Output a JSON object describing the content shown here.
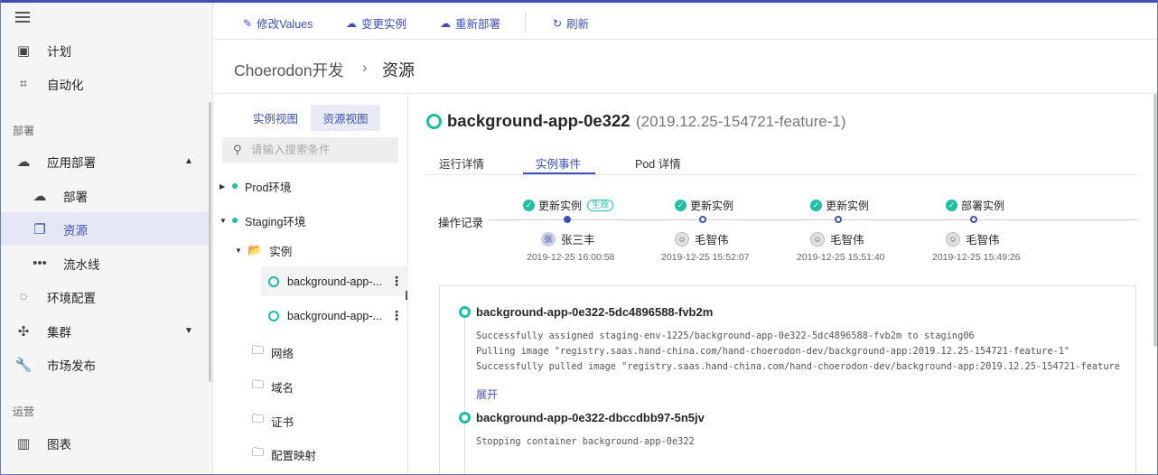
{
  "sidebar": {
    "items": [
      {
        "label": "计划",
        "icon": "calendar-icon"
      },
      {
        "label": "自动化",
        "icon": "automation-icon"
      },
      {
        "label": "应用部署",
        "icon": "cloud-icon"
      },
      {
        "label": "部署",
        "icon": "cloud-upload-icon"
      },
      {
        "label": "资源",
        "icon": "file-copy-icon"
      },
      {
        "label": "流水线",
        "icon": "dots-icon"
      },
      {
        "label": "环境配置",
        "icon": "ring-icon"
      },
      {
        "label": "集群",
        "icon": "cluster-icon"
      },
      {
        "label": "市场发布",
        "icon": "wrench-icon"
      },
      {
        "label": "图表",
        "icon": "chart-icon"
      }
    ],
    "sections": {
      "deploy": "部署",
      "ops": "运营"
    }
  },
  "toolbar": {
    "modify_values": "修改Values",
    "change_instance": "变更实例",
    "redeploy": "重新部署",
    "refresh": "刷新"
  },
  "breadcrumb": {
    "project": "Choerodon开发",
    "separator": "›",
    "current": "资源"
  },
  "tree": {
    "tab_instance": "实例视图",
    "tab_resource": "资源视图",
    "search_placeholder": "请输入搜索条件",
    "env_prod": "Prod环境",
    "env_staging": "Staging环境",
    "folder_instance": "实例",
    "instances": [
      "background-app-...",
      "background-app-..."
    ],
    "folders": [
      "网络",
      "域名",
      "证书",
      "配置映射"
    ]
  },
  "detail": {
    "title": "background-app-0e322",
    "version": "(2019.12.25-154721-feature-1)",
    "tabs": [
      "运行详情",
      "实例事件",
      "Pod 详情"
    ],
    "record_label": "操作记录",
    "records": [
      {
        "action": "更新实例",
        "tag": "生效",
        "user": "张三丰",
        "avatar": "张",
        "time": "2019-12-25 16:00:58"
      },
      {
        "action": "更新实例",
        "tag": "",
        "user": "毛智伟",
        "avatar": "",
        "time": "2019-12-25 15:52:07"
      },
      {
        "action": "更新实例",
        "tag": "",
        "user": "毛智伟",
        "avatar": "",
        "time": "2019-12-25 15:51:40"
      },
      {
        "action": "部署实例",
        "tag": "",
        "user": "毛智伟",
        "avatar": "",
        "time": "2019-12-25 15:49:26"
      }
    ],
    "events": [
      {
        "name": "background-app-0e322-5dc4896588-fvb2m",
        "logs": [
          "Successfully assigned staging-env-1225/background-app-0e322-5dc4896588-fvb2m to staging06",
          "Pulling image \"registry.saas.hand-china.com/hand-choerodon-dev/background-app:2019.12.25-154721-feature-1\"",
          "Successfully pulled image \"registry.saas.hand-china.com/hand-choerodon-dev/background-app:2019.12.25-154721-feature"
        ],
        "expand": "展开"
      },
      {
        "name": "background-app-0e322-dbccdbb97-5n5jv",
        "logs": [
          "Stopping container background-app-0e322"
        ]
      }
    ]
  },
  "colors": {
    "primary": "#3f51b5",
    "success": "#1fbfa4"
  }
}
